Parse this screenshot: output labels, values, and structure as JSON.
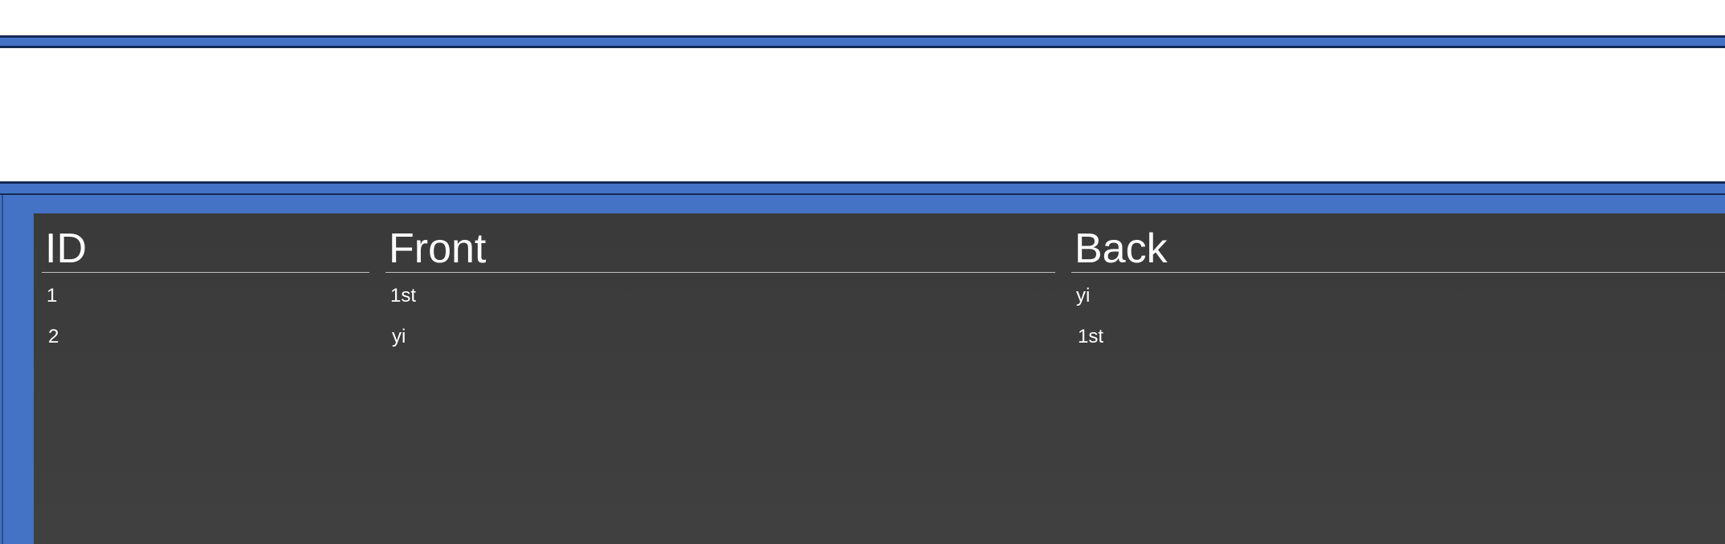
{
  "table": {
    "columns": [
      "ID",
      "Front",
      "Back"
    ],
    "rows": [
      {
        "id": "1",
        "front": "1st",
        "back": "yi"
      },
      {
        "id": "2",
        "front": "yi",
        "back": "1st"
      }
    ]
  },
  "colors": {
    "frame_blue": "#4472c4",
    "frame_border": "#142a55",
    "panel_dark": "#3d3d3d",
    "text": "#ffffff"
  }
}
